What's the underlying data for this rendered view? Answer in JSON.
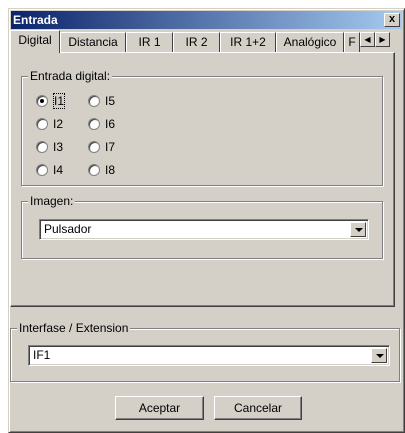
{
  "window": {
    "title": "Entrada",
    "close_glyph": "x"
  },
  "tabs": [
    {
      "label": "Digital",
      "active": true
    },
    {
      "label": "Distancia"
    },
    {
      "label": "IR 1"
    },
    {
      "label": "IR 2"
    },
    {
      "label": "IR 1+2"
    },
    {
      "label": "Analógico"
    },
    {
      "label": "F"
    }
  ],
  "tab_scroll": {
    "left_glyph": "◀",
    "right_glyph": "▶"
  },
  "digital_input": {
    "legend": "Entrada digital:",
    "options": [
      "I1",
      "I2",
      "I3",
      "I4",
      "I5",
      "I6",
      "I7",
      "I8"
    ],
    "selected": "I1"
  },
  "image": {
    "legend": "Imagen:",
    "value": "Pulsador"
  },
  "interface": {
    "legend": "Interfase / Extension",
    "value": "IF1"
  },
  "buttons": {
    "accept": "Aceptar",
    "cancel": "Cancelar"
  },
  "colors": {
    "title_bar_start": "#0a246a",
    "title_bar_end": "#a6caf0",
    "face": "#d4d0c8"
  }
}
